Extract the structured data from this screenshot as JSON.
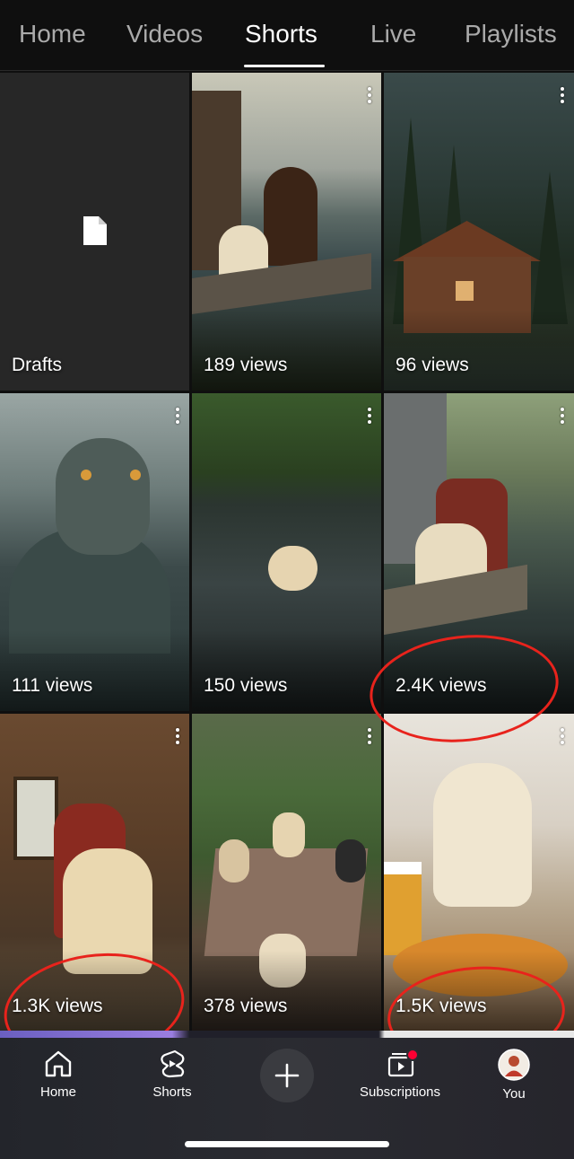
{
  "tabs": [
    {
      "label": "Home",
      "active": false
    },
    {
      "label": "Videos",
      "active": false
    },
    {
      "label": "Shorts",
      "active": true
    },
    {
      "label": "Live",
      "active": false
    },
    {
      "label": "Playlists",
      "active": false
    }
  ],
  "tiles": [
    {
      "label": "Drafts"
    },
    {
      "views": "189 views"
    },
    {
      "views": "96 views"
    },
    {
      "views": "111 views"
    },
    {
      "views": "150 views"
    },
    {
      "views": "2.4K views"
    },
    {
      "views": "1.3K views"
    },
    {
      "views": "378 views"
    },
    {
      "views": "1.5K views"
    }
  ],
  "annotations": {
    "color": "#e8231c"
  },
  "bottom_nav": {
    "home": "Home",
    "shorts": "Shorts",
    "subscriptions": "Subscriptions",
    "you": "You",
    "notification_color": "#ff0033"
  },
  "icons": [
    "file-icon",
    "more-vert-icon",
    "home-icon",
    "shorts-icon",
    "plus-icon",
    "subscriptions-icon",
    "avatar"
  ]
}
